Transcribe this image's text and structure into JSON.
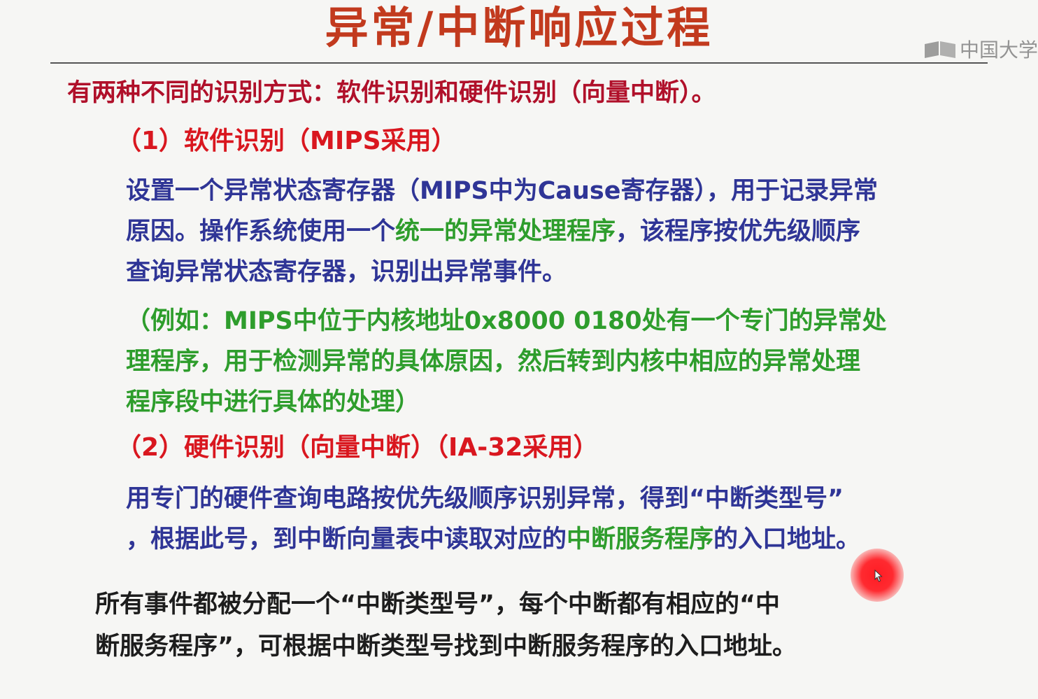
{
  "title": "异常/中断响应过程",
  "watermark": {
    "text": "中国大学"
  },
  "intro": "有两种不同的识别方式：软件识别和硬件识别（向量中断）。",
  "section1": {
    "heading": "（1）软件识别（MIPS采用）",
    "l1": "设置一个异常状态寄存器（MIPS中为Cause寄存器），用于记录异常",
    "l2_a": "原因。操作系统使用一个",
    "l2_b": "统一的异常处理程序",
    "l2_c": "，该程序按优先级顺序",
    "l3": "查询异常状态寄存器，识别出异常事件。",
    "ex1": "（例如：MIPS中位于内核地址0x8000 0180处有一个专门的异常处",
    "ex2": "理程序，用于检测异常的具体原因，然后转到内核中相应的异常处理",
    "ex3": "程序段中进行具体的处理）"
  },
  "section2": {
    "heading": "（2）硬件识别（向量中断）（IA-32采用）",
    "l1": "用专门的硬件查询电路按优先级顺序识别异常，得到“中断类型号”",
    "l2_a": "，根据此号，到中断向量表中读取对应的",
    "l2_b": "中断服务程序",
    "l2_c": "的入口地址。"
  },
  "summary": {
    "l1": "所有事件都被分配一个“中断类型号”，每个中断都有相应的“中",
    "l2": "断服务程序”，可根据中断类型号找到中断服务程序的入口地址。"
  },
  "colors": {
    "title": "#c23a1e",
    "heading": "#d9171f",
    "body": "#2f3596",
    "highlight": "#2e9d2c",
    "summary": "#1d1d1d"
  }
}
